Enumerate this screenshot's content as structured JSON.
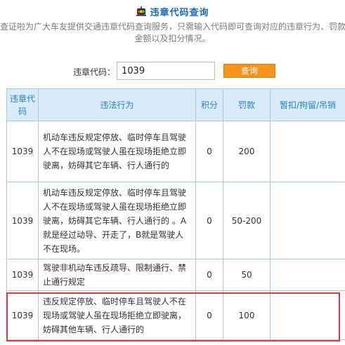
{
  "header": {
    "title": "违章代码查询",
    "icon": "traffic-light-icon",
    "intro_line1": "查证啦为广大车友提供交通违章代码查询服务，只需输入代码即可查询对应的违章行为、罚款",
    "intro_line2": "金额以及扣分情况。"
  },
  "search": {
    "label": "违章代码：",
    "value": "1039",
    "button_label": "查询"
  },
  "table": {
    "headers": {
      "code": "违章代码",
      "action": "违法行为",
      "points": "积分",
      "fine": "罚款",
      "suspension": "暂扣/拘留/吊销"
    },
    "rows": [
      {
        "code": "1039",
        "action": "机动车违反规定停放、临时停车且驾驶人不在现场或驾驶人虽在现场拒绝立即驶离，妨碍其它车辆、行人通行的",
        "points": "0",
        "fine": "200",
        "suspension": ""
      },
      {
        "code": "1039",
        "action": "机动车违反规定停放、临时停车且驾驶人不在现场或驾驶人虽在现场拒绝立即驶离，妨碍其它车辆、行人通行的 。A就是经过动导、开走了，B就是驾驶人不在现场。",
        "points": "0",
        "fine": "50-200",
        "suspension": ""
      },
      {
        "code": "1039",
        "action": "驾驶非机动车违反疏导、限制通行、禁止通行规定",
        "points": "0",
        "fine": "50",
        "suspension": ""
      },
      {
        "code": "1039",
        "action": "违反规定停放、临时停车且驾驶人不在现场或驾驶人虽在现场拒绝立即驶离，妨碍其他车辆、行人通行的",
        "points": "0",
        "fine": "100",
        "suspension": "",
        "highlighted": true
      }
    ]
  },
  "colors": {
    "title": "#1a6fb0",
    "header_bg": "#d8ebf9",
    "header_text": "#2a7fc0",
    "border": "#a9c8e2",
    "button": "#f6921e",
    "highlight": "#e8343a"
  }
}
